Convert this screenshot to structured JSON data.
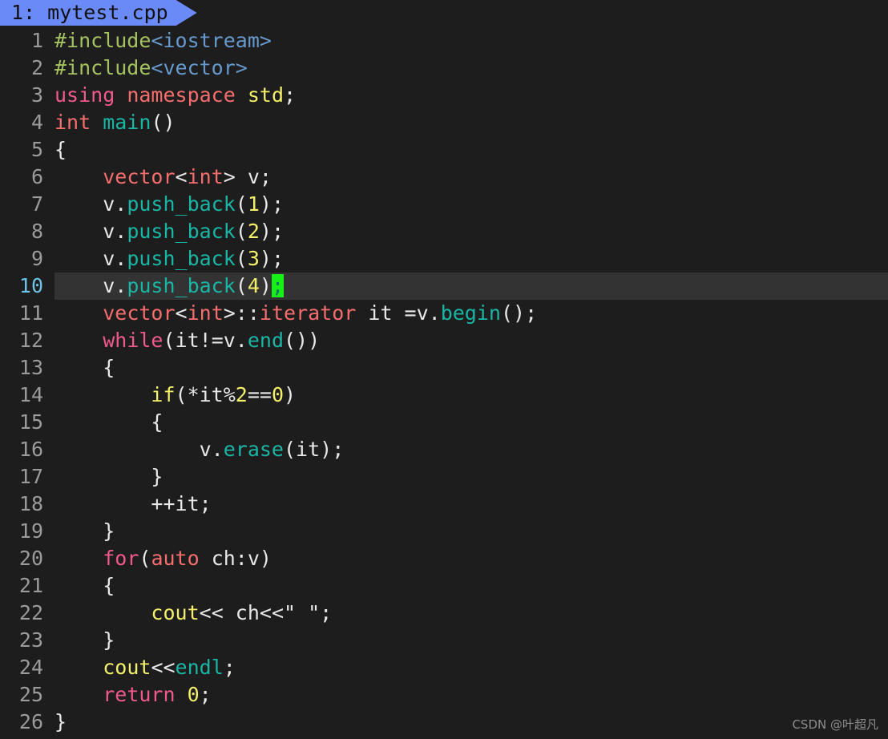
{
  "window": {
    "background": "#1d1d1d",
    "highlight_background": "#333333",
    "accent": "#6a8bf7",
    "cursor_color": "#16f016"
  },
  "tabbar": {
    "active_tab": {
      "index_label": "1:",
      "filename": "mytest.cpp",
      "full_label": "1: mytest.cpp"
    }
  },
  "editor": {
    "current_line": 10,
    "total_lines": 26,
    "cursor_char": ";",
    "lines": [
      {
        "number": "1",
        "text": "#include<iostream>"
      },
      {
        "number": "2",
        "text": "#include<vector>"
      },
      {
        "number": "3",
        "text": "using namespace std;"
      },
      {
        "number": "4",
        "text": "int main()"
      },
      {
        "number": "5",
        "text": "{"
      },
      {
        "number": "6",
        "text": "    vector<int> v;"
      },
      {
        "number": "7",
        "text": "    v.push_back(1);"
      },
      {
        "number": "8",
        "text": "    v.push_back(2);"
      },
      {
        "number": "9",
        "text": "    v.push_back(3);"
      },
      {
        "number": "10",
        "text": "    v.push_back(4);"
      },
      {
        "number": "11",
        "text": "    vector<int>::iterator it =v.begin();"
      },
      {
        "number": "12",
        "text": "    while(it!=v.end())"
      },
      {
        "number": "13",
        "text": "    {"
      },
      {
        "number": "14",
        "text": "        if(*it%2==0)"
      },
      {
        "number": "15",
        "text": "        {"
      },
      {
        "number": "16",
        "text": "            v.erase(it);"
      },
      {
        "number": "17",
        "text": "        }"
      },
      {
        "number": "18",
        "text": "        ++it;"
      },
      {
        "number": "19",
        "text": "    }"
      },
      {
        "number": "20",
        "text": "    for(auto ch:v)"
      },
      {
        "number": "21",
        "text": "    {"
      },
      {
        "number": "22",
        "text": "        cout<< ch<<\" \";"
      },
      {
        "number": "23",
        "text": "    }"
      },
      {
        "number": "24",
        "text": "    cout<<endl;"
      },
      {
        "number": "25",
        "text": "    return 0;"
      },
      {
        "number": "26",
        "text": "}"
      }
    ],
    "line_numbers": [
      "1",
      "2",
      "3",
      "4",
      "5",
      "6",
      "7",
      "8",
      "9",
      "10",
      "11",
      "12",
      "13",
      "14",
      "15",
      "16",
      "17",
      "18",
      "19",
      "20",
      "21",
      "22",
      "23",
      "24",
      "25",
      "26"
    ],
    "tokens": {
      "l1": [
        [
          "#include",
          "t-pre"
        ],
        [
          "<iostream>",
          "t-hdr"
        ]
      ],
      "l2": [
        [
          "#include",
          "t-pre"
        ],
        [
          "<vector>",
          "t-hdr"
        ]
      ],
      "l3": [
        [
          "using",
          "t-kw"
        ],
        [
          " ",
          "t-plain"
        ],
        [
          "namespace",
          "t-type"
        ],
        [
          " ",
          "t-plain"
        ],
        [
          "std",
          "t-num"
        ],
        [
          ";",
          "t-plain"
        ]
      ],
      "l4": [
        [
          "int",
          "t-type"
        ],
        [
          " ",
          "t-plain"
        ],
        [
          "main",
          "t-fn"
        ],
        [
          "()",
          "t-plain"
        ]
      ],
      "l5": [
        [
          "{",
          "t-brace"
        ]
      ],
      "l6": [
        [
          "    ",
          "t-plain"
        ],
        [
          "vector",
          "t-type"
        ],
        [
          "<",
          "t-plain"
        ],
        [
          "int",
          "t-type"
        ],
        [
          "> v;",
          "t-plain"
        ]
      ],
      "l7": [
        [
          "    v.",
          "t-plain"
        ],
        [
          "push_back",
          "t-fn"
        ],
        [
          "(",
          "t-plain"
        ],
        [
          "1",
          "t-num"
        ],
        [
          ");",
          "t-plain"
        ]
      ],
      "l8": [
        [
          "    v.",
          "t-plain"
        ],
        [
          "push_back",
          "t-fn"
        ],
        [
          "(",
          "t-plain"
        ],
        [
          "2",
          "t-num"
        ],
        [
          ");",
          "t-plain"
        ]
      ],
      "l9": [
        [
          "    v.",
          "t-plain"
        ],
        [
          "push_back",
          "t-fn"
        ],
        [
          "(",
          "t-plain"
        ],
        [
          "3",
          "t-num"
        ],
        [
          ");",
          "t-plain"
        ]
      ],
      "l10": [
        [
          "    v.",
          "t-plain"
        ],
        [
          "push_back",
          "t-fn"
        ],
        [
          "(",
          "t-plain"
        ],
        [
          "4",
          "t-num"
        ],
        [
          ")",
          "t-plain"
        ],
        [
          ";",
          "cursor"
        ]
      ],
      "l11": [
        [
          "    ",
          "t-plain"
        ],
        [
          "vector",
          "t-type"
        ],
        [
          "<",
          "t-plain"
        ],
        [
          "int",
          "t-type"
        ],
        [
          ">",
          "t-plain"
        ],
        [
          "::",
          "t-plain"
        ],
        [
          "iterator",
          "t-type"
        ],
        [
          " it =v.",
          "t-plain"
        ],
        [
          "begin",
          "t-fn"
        ],
        [
          "();",
          "t-plain"
        ]
      ],
      "l12": [
        [
          "    ",
          "t-plain"
        ],
        [
          "while",
          "t-kw"
        ],
        [
          "(it!=v.",
          "t-plain"
        ],
        [
          "end",
          "t-fn"
        ],
        [
          "())",
          "t-plain"
        ]
      ],
      "l13": [
        [
          "    {",
          "t-brace"
        ]
      ],
      "l14": [
        [
          "        ",
          "t-plain"
        ],
        [
          "if",
          "t-num"
        ],
        [
          "(*it%",
          "t-plain"
        ],
        [
          "2",
          "t-num"
        ],
        [
          "==",
          "t-plain"
        ],
        [
          "0",
          "t-num"
        ],
        [
          ")",
          "t-plain"
        ]
      ],
      "l15": [
        [
          "        {",
          "t-brace"
        ]
      ],
      "l16": [
        [
          "            v.",
          "t-plain"
        ],
        [
          "erase",
          "t-fn"
        ],
        [
          "(it);",
          "t-plain"
        ]
      ],
      "l17": [
        [
          "        }",
          "t-brace"
        ]
      ],
      "l18": [
        [
          "        ++it;",
          "t-plain"
        ]
      ],
      "l19": [
        [
          "    }",
          "t-brace"
        ]
      ],
      "l20": [
        [
          "    ",
          "t-plain"
        ],
        [
          "for",
          "t-kw"
        ],
        [
          "(",
          "t-plain"
        ],
        [
          "auto",
          "t-type"
        ],
        [
          " ch:v)",
          "t-plain"
        ]
      ],
      "l21": [
        [
          "    {",
          "t-brace"
        ]
      ],
      "l22": [
        [
          "        ",
          "t-plain"
        ],
        [
          "cout",
          "t-num"
        ],
        [
          "<< ch<<\" \";",
          "t-plain"
        ]
      ],
      "l23": [
        [
          "    }",
          "t-brace"
        ]
      ],
      "l24": [
        [
          "    ",
          "t-plain"
        ],
        [
          "cout",
          "t-num"
        ],
        [
          "<<",
          "t-plain"
        ],
        [
          "endl",
          "t-fn"
        ],
        [
          ";",
          "t-plain"
        ]
      ],
      "l25": [
        [
          "    ",
          "t-plain"
        ],
        [
          "return",
          "t-kw"
        ],
        [
          " ",
          "t-plain"
        ],
        [
          "0",
          "t-num"
        ],
        [
          ";",
          "t-plain"
        ]
      ],
      "l26": [
        [
          "}",
          "t-brace"
        ]
      ]
    }
  },
  "watermark": {
    "text": "CSDN @叶超凡"
  }
}
